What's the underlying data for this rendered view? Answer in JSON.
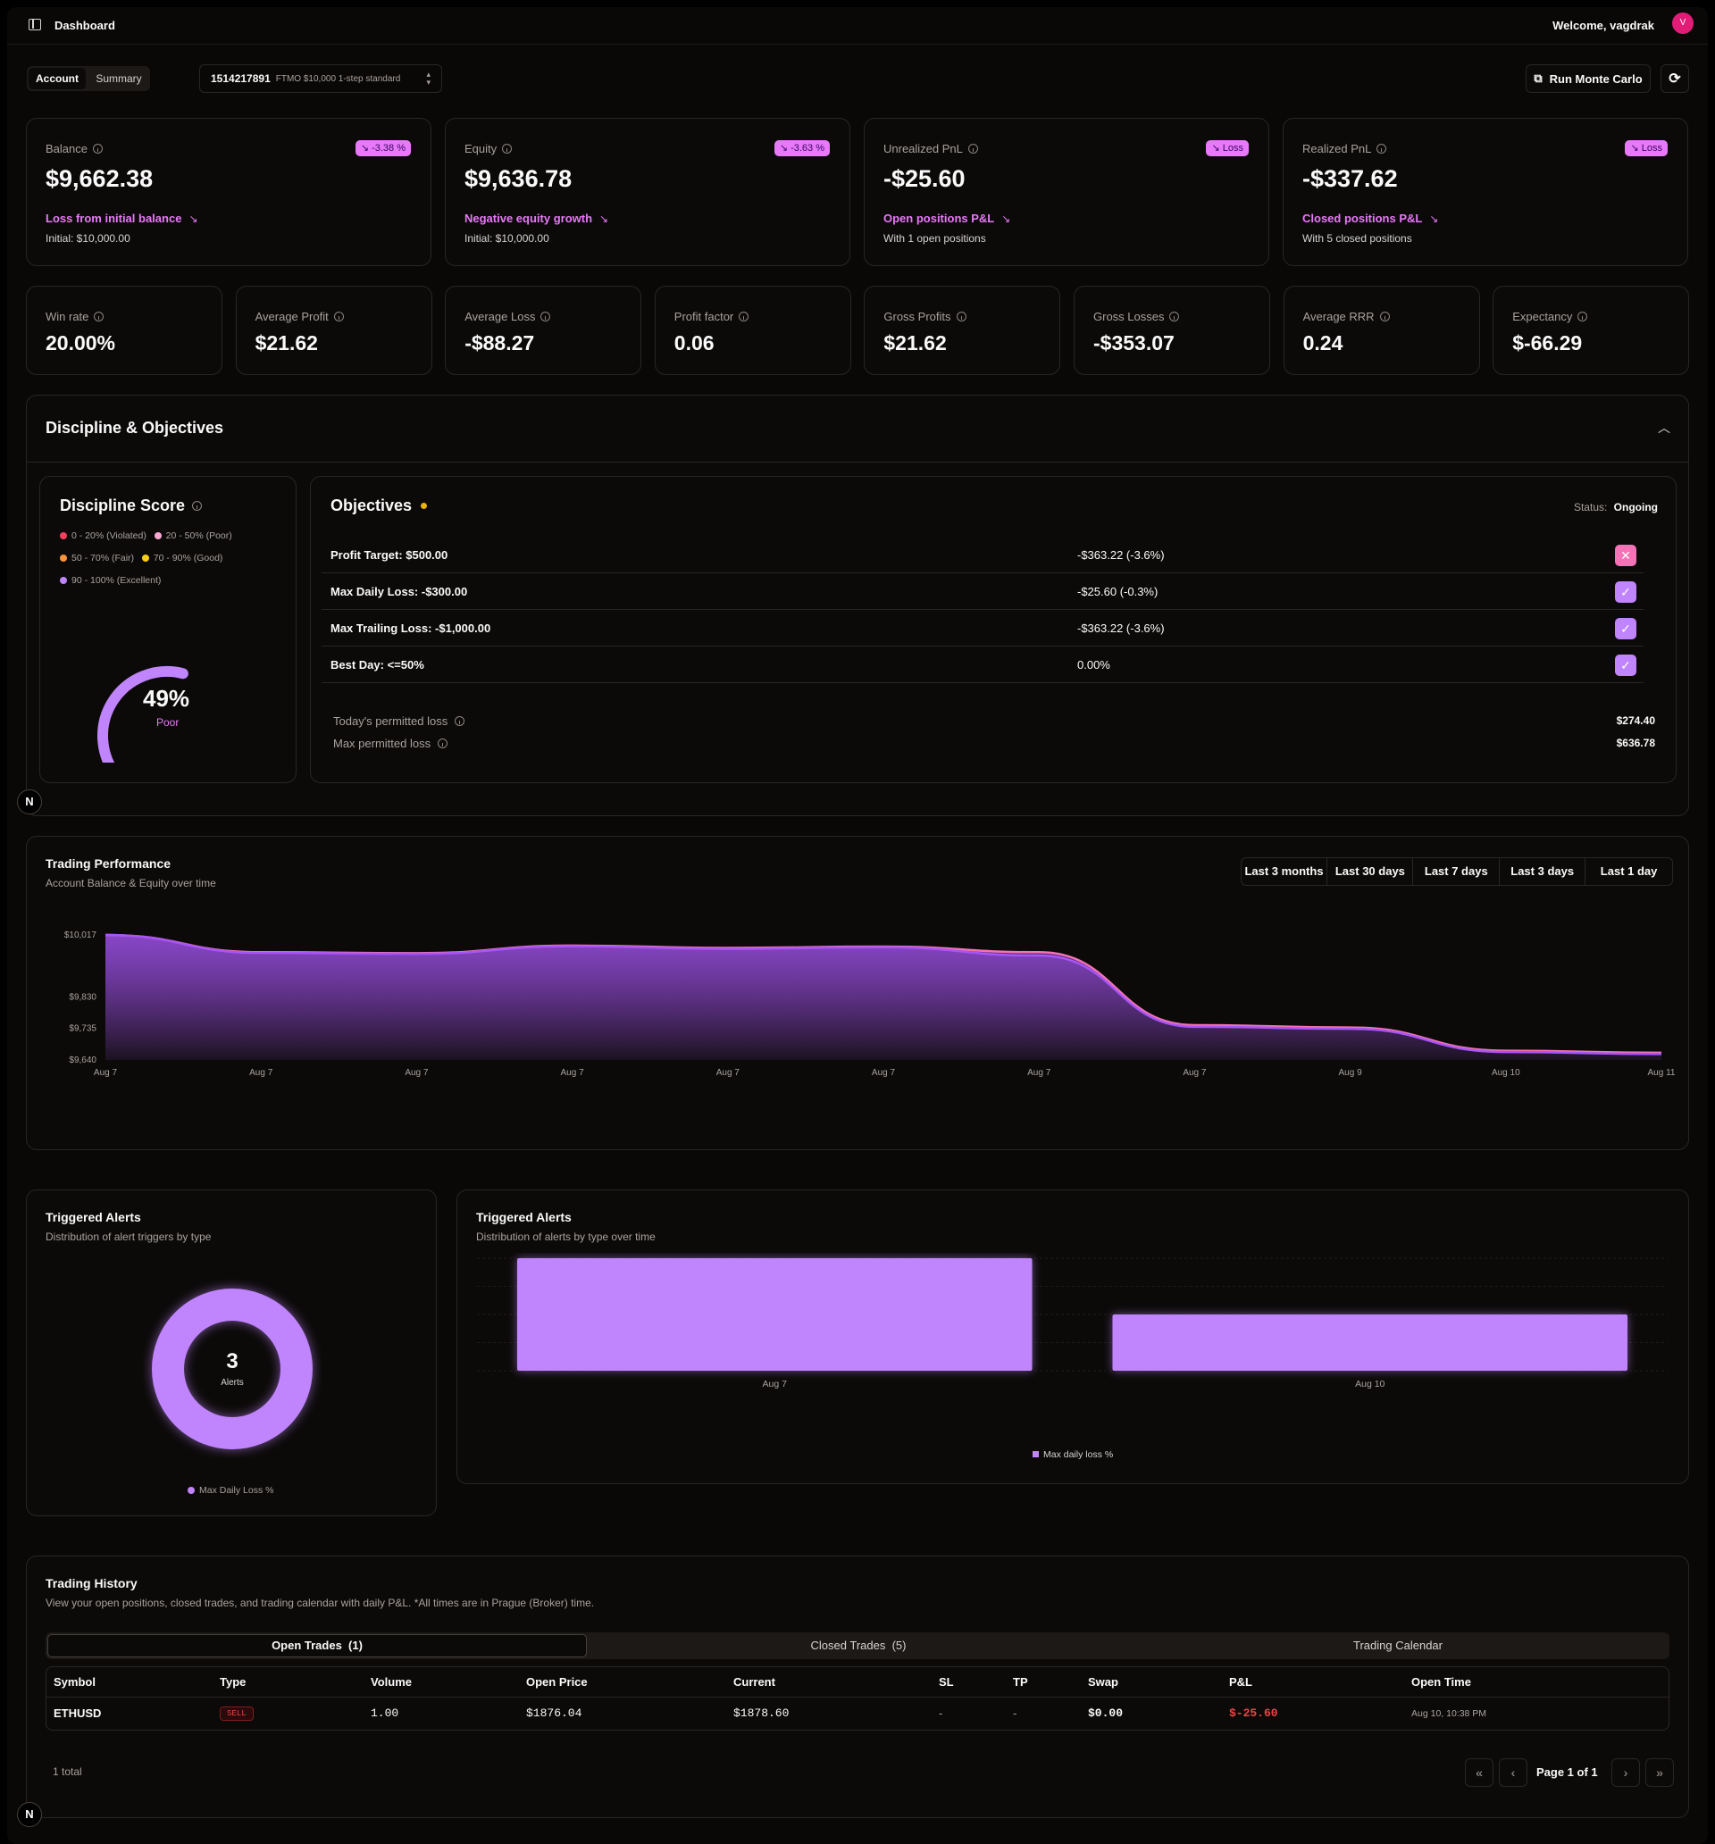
{
  "header": {
    "title": "Dashboard",
    "welcome": "Welcome, vagdrak",
    "avatar_initial": "V"
  },
  "toolbar": {
    "tabs": [
      "Account",
      "Summary"
    ],
    "account_id": "1514217891",
    "account_desc": "FTMO $10,000 1-step standard",
    "monte_carlo": "Run Monte Carlo"
  },
  "stats": [
    {
      "label": "Balance",
      "value": "$9,662.38",
      "badge": "↘ -3.38 %",
      "link": "Loss from initial balance",
      "sub": "Initial: $10,000.00"
    },
    {
      "label": "Equity",
      "value": "$9,636.78",
      "badge": "↘ -3.63 %",
      "link": "Negative equity growth",
      "sub": "Initial: $10,000.00"
    },
    {
      "label": "Unrealized PnL",
      "value": "-$25.60",
      "badge": "↘ Loss",
      "link": "Open positions P&L",
      "sub": "With 1 open positions"
    },
    {
      "label": "Realized PnL",
      "value": "-$337.62",
      "badge": "↘ Loss",
      "link": "Closed positions P&L",
      "sub": "With 5 closed positions"
    }
  ],
  "metrics": [
    {
      "label": "Win rate",
      "value": "20.00%"
    },
    {
      "label": "Average Profit",
      "value": "$21.62"
    },
    {
      "label": "Average Loss",
      "value": "-$88.27"
    },
    {
      "label": "Profit factor",
      "value": "0.06"
    },
    {
      "label": "Gross Profits",
      "value": "$21.62"
    },
    {
      "label": "Gross Losses",
      "value": "-$353.07"
    },
    {
      "label": "Average RRR",
      "value": "0.24"
    },
    {
      "label": "Expectancy",
      "value": "$-66.29"
    }
  ],
  "discipline": {
    "section_title": "Discipline & Objectives",
    "score_title": "Discipline Score",
    "legend": [
      "0 - 20% (Violated)",
      "20 - 50% (Poor)",
      "50 - 70% (Fair)",
      "70 - 90% (Good)",
      "90 - 100% (Excellent)"
    ],
    "legend_colors": [
      "#f43f5e",
      "#f9a8d4",
      "#fb923c",
      "#facc15",
      "#c084fc"
    ],
    "score": 49,
    "score_text": "49%",
    "score_label": "Poor"
  },
  "objectives": {
    "title": "Objectives",
    "status_label": "Status:",
    "status_value": "Ongoing",
    "rows": [
      {
        "name": "Profit Target: $500.00",
        "value": "-$363.22 (-3.6%)",
        "status": "fail"
      },
      {
        "name": "Max Daily Loss: -$300.00",
        "value": "-$25.60 (-0.3%)",
        "status": "pass"
      },
      {
        "name": "Max Trailing Loss: -$1,000.00",
        "value": "-$363.22 (-3.6%)",
        "status": "pass"
      },
      {
        "name": "Best Day: <=50%",
        "value": "0.00%",
        "status": "pass"
      }
    ],
    "permitted": [
      {
        "label": "Today's permitted loss",
        "value": "$274.40"
      },
      {
        "label": "Max permitted loss",
        "value": "$636.78"
      }
    ]
  },
  "performance": {
    "title": "Trading Performance",
    "subtitle": "Account Balance & Equity over time",
    "ranges": [
      "Last 3 months",
      "Last 30 days",
      "Last 7 days",
      "Last 3 days",
      "Last 1 day"
    ]
  },
  "chart_data": [
    {
      "type": "area",
      "x": [
        "Aug 7",
        "Aug 7",
        "Aug 7",
        "Aug 7",
        "Aug 7",
        "Aug 7",
        "Aug 7",
        "Aug 7",
        "Aug 9",
        "Aug 10",
        "Aug 11"
      ],
      "yticks": [
        "$10,017",
        "$9,830",
        "$9,735",
        "$9,640"
      ],
      "ylim": [
        9640,
        10017
      ],
      "series": [
        {
          "values": [
            10017,
            9965,
            9962,
            9985,
            9978,
            9982,
            9965,
            9745,
            9738,
            9668,
            9662
          ],
          "color": "#f472b6"
        },
        {
          "values": [
            10017,
            9963,
            9960,
            9983,
            9975,
            9980,
            9955,
            9740,
            9734,
            9664,
            9658
          ],
          "color": "#a855f7"
        }
      ]
    },
    {
      "type": "pie",
      "title": "Triggered Alerts",
      "subtitle": "Distribution of alert triggers by type",
      "total": "3",
      "center_label": "Alerts",
      "legend": [
        "Max Daily Loss %"
      ],
      "values": [
        3
      ]
    },
    {
      "type": "bar",
      "title": "Triggered Alerts",
      "subtitle": "Distribution of alerts by type over time",
      "categories": [
        "Aug 7",
        "Aug 10"
      ],
      "values": [
        2,
        1
      ],
      "legend": [
        "Max daily loss %"
      ]
    }
  ],
  "history": {
    "title": "Trading History",
    "subtitle": "View your open positions, closed trades, and trading calendar with daily P&L. *All times are in Prague (Broker) time.",
    "tabs": [
      {
        "label": "Open Trades",
        "count": "(1)"
      },
      {
        "label": "Closed Trades",
        "count": "(5)"
      },
      {
        "label": "Trading Calendar",
        "count": ""
      }
    ],
    "columns": [
      "Symbol",
      "Type",
      "Volume",
      "Open Price",
      "Current",
      "SL",
      "TP",
      "Swap",
      "P&L",
      "Open Time"
    ],
    "row": {
      "symbol": "ETHUSD",
      "type": "SELL",
      "volume": "1.00",
      "open_price": "$1876.04",
      "current": "$1878.60",
      "sl": "-",
      "tp": "-",
      "swap": "$0.00",
      "pnl": "$-25.60",
      "open_time": "Aug 10, 10:38 PM"
    },
    "total": "1 total",
    "page": "Page 1 of 1"
  }
}
